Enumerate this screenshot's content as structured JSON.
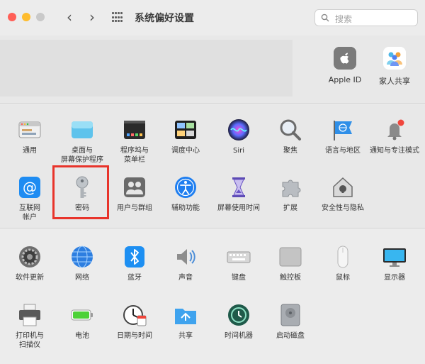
{
  "window": {
    "title": "系统偏好设置"
  },
  "search": {
    "placeholder": "搜索"
  },
  "account": {
    "items": [
      {
        "label": "Apple ID",
        "icon": "apple-id-icon"
      },
      {
        "label": "家人共享",
        "icon": "family-sharing-icon"
      }
    ]
  },
  "section1": {
    "row1": [
      {
        "label": "通用",
        "icon": "general-icon"
      },
      {
        "label": "桌面与\n屏幕保护程序",
        "icon": "desktop-icon"
      },
      {
        "label": "程序坞与\n菜单栏",
        "icon": "dock-icon"
      },
      {
        "label": "调度中心",
        "icon": "mission-control-icon"
      },
      {
        "label": "Siri",
        "icon": "siri-icon"
      },
      {
        "label": "聚焦",
        "icon": "spotlight-icon"
      },
      {
        "label": "语言与地区",
        "icon": "language-region-icon"
      },
      {
        "label": "通知与专注模式",
        "icon": "notifications-icon"
      }
    ],
    "row2": [
      {
        "label": "互联网\n帐户",
        "icon": "internet-accounts-icon"
      },
      {
        "label": "密码",
        "icon": "passwords-icon"
      },
      {
        "label": "用户与群组",
        "icon": "users-groups-icon"
      },
      {
        "label": "辅助功能",
        "icon": "accessibility-icon"
      },
      {
        "label": "屏幕使用时间",
        "icon": "screen-time-icon"
      },
      {
        "label": "扩展",
        "icon": "extensions-icon"
      },
      {
        "label": "安全性与隐私",
        "icon": "security-privacy-icon"
      }
    ]
  },
  "section2": {
    "row1": [
      {
        "label": "软件更新",
        "icon": "software-update-icon"
      },
      {
        "label": "网络",
        "icon": "network-icon"
      },
      {
        "label": "蓝牙",
        "icon": "bluetooth-icon"
      },
      {
        "label": "声音",
        "icon": "sound-icon"
      },
      {
        "label": "键盘",
        "icon": "keyboard-icon"
      },
      {
        "label": "触控板",
        "icon": "trackpad-icon"
      },
      {
        "label": "鼠标",
        "icon": "mouse-icon"
      },
      {
        "label": "显示器",
        "icon": "displays-icon"
      }
    ],
    "row2": [
      {
        "label": "打印机与\n扫描仪",
        "icon": "printers-scanners-icon"
      },
      {
        "label": "电池",
        "icon": "battery-icon"
      },
      {
        "label": "日期与时间",
        "icon": "date-time-icon"
      },
      {
        "label": "共享",
        "icon": "sharing-icon"
      },
      {
        "label": "时间机器",
        "icon": "time-machine-icon"
      },
      {
        "label": "启动磁盘",
        "icon": "startup-disk-icon"
      }
    ]
  },
  "colors": {
    "highlight": "#e8342b",
    "close": "#ff5f57",
    "minimize": "#febc2e"
  }
}
